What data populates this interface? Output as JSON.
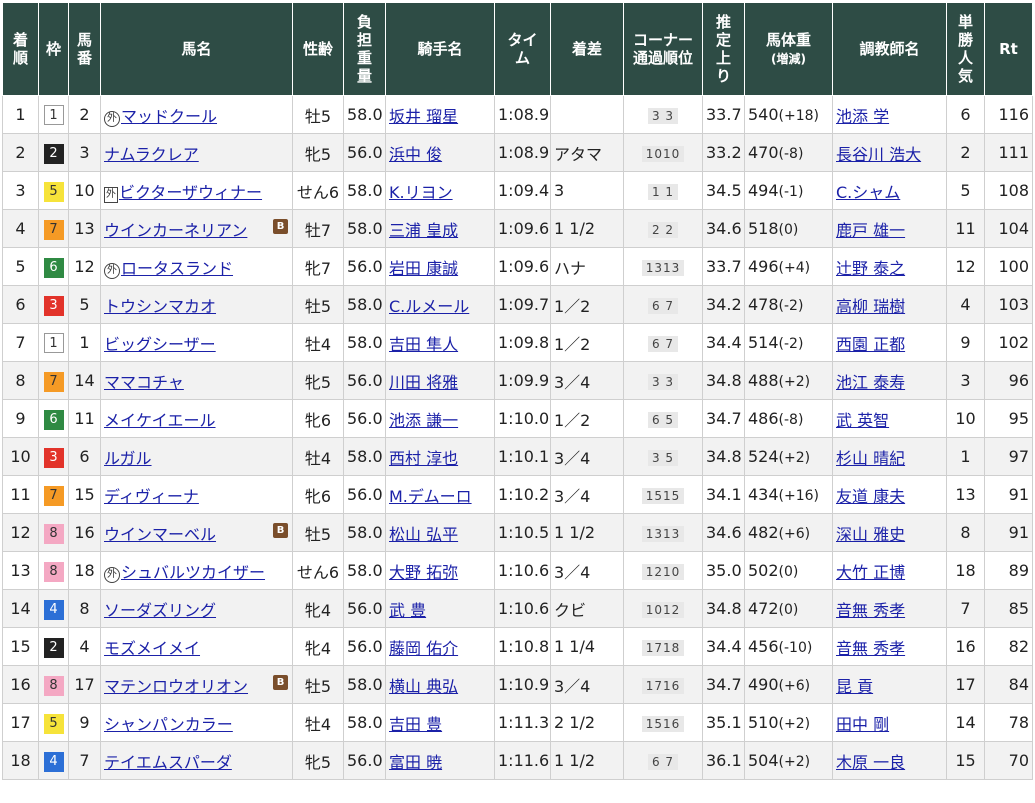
{
  "headers": {
    "rank": [
      "着",
      "順"
    ],
    "waku": [
      "枠"
    ],
    "umaban": [
      "馬",
      "番"
    ],
    "name": [
      "馬名"
    ],
    "sexage": [
      "性齢"
    ],
    "weight": [
      "負",
      "担",
      "重",
      "量"
    ],
    "jockey": [
      "騎手名"
    ],
    "time": [
      "タイ",
      "ム"
    ],
    "margin": [
      "着差"
    ],
    "corner": [
      "コーナー",
      "通過順位"
    ],
    "last3f": [
      "推",
      "定",
      "上",
      "り"
    ],
    "body": [
      "馬体重",
      "(増減)"
    ],
    "trainer": [
      "調教師名"
    ],
    "pop": [
      "単",
      "勝",
      "人",
      "気"
    ],
    "rt": [
      "Rt"
    ]
  },
  "rows": [
    {
      "rank": "1",
      "waku": "1",
      "umaban": "2",
      "mark": "外",
      "mark_style": "maru",
      "name": "マッドクール",
      "blinker": "",
      "sexage": "牡5",
      "weight": "58.0",
      "jockey": "坂井 瑠星",
      "time": "1:08.9",
      "margin": "",
      "corner": "3 3",
      "last3f": "33.7",
      "bodyw": "540",
      "bodychg": "(+18)",
      "trainer": "池添 学",
      "pop": "6",
      "rt": "116"
    },
    {
      "rank": "2",
      "waku": "2",
      "umaban": "3",
      "mark": "",
      "mark_style": "",
      "name": "ナムラクレア",
      "blinker": "",
      "sexage": "牝5",
      "weight": "56.0",
      "jockey": "浜中 俊",
      "time": "1:08.9",
      "margin": "アタマ",
      "corner": "1010",
      "last3f": "33.2",
      "bodyw": "470",
      "bodychg": "(-8)",
      "trainer": "長谷川 浩大",
      "pop": "2",
      "rt": "111"
    },
    {
      "rank": "3",
      "waku": "5",
      "umaban": "10",
      "mark": "外",
      "mark_style": "kaku",
      "name": "ビクターザウィナー",
      "blinker": "",
      "sexage": "せん6",
      "weight": "58.0",
      "jockey": "K.リヨン",
      "time": "1:09.4",
      "margin": "3",
      "corner": "1 1",
      "last3f": "34.5",
      "bodyw": "494",
      "bodychg": "(-1)",
      "trainer": "C.シャム",
      "pop": "5",
      "rt": "108"
    },
    {
      "rank": "4",
      "waku": "7",
      "umaban": "13",
      "mark": "",
      "mark_style": "",
      "name": "ウインカーネリアン",
      "blinker": "B",
      "sexage": "牡7",
      "weight": "58.0",
      "jockey": "三浦 皇成",
      "time": "1:09.6",
      "margin": "1 1/2",
      "corner": "2 2",
      "last3f": "34.6",
      "bodyw": "518",
      "bodychg": "(0)",
      "trainer": "鹿戸 雄一",
      "pop": "11",
      "rt": "104"
    },
    {
      "rank": "5",
      "waku": "6",
      "umaban": "12",
      "mark": "外",
      "mark_style": "maru",
      "name": "ロータスランド",
      "blinker": "",
      "sexage": "牝7",
      "weight": "56.0",
      "jockey": "岩田 康誠",
      "time": "1:09.6",
      "margin": "ハナ",
      "corner": "1313",
      "last3f": "33.7",
      "bodyw": "496",
      "bodychg": "(+4)",
      "trainer": "辻野 泰之",
      "pop": "12",
      "rt": "100"
    },
    {
      "rank": "6",
      "waku": "3",
      "umaban": "5",
      "mark": "",
      "mark_style": "",
      "name": "トウシンマカオ",
      "blinker": "",
      "sexage": "牡5",
      "weight": "58.0",
      "jockey": "C.ルメール",
      "time": "1:09.7",
      "margin": "1／2",
      "corner": "6 7",
      "last3f": "34.2",
      "bodyw": "478",
      "bodychg": "(-2)",
      "trainer": "高柳 瑞樹",
      "pop": "4",
      "rt": "103"
    },
    {
      "rank": "7",
      "waku": "1",
      "umaban": "1",
      "mark": "",
      "mark_style": "",
      "name": "ビッグシーザー",
      "blinker": "",
      "sexage": "牡4",
      "weight": "58.0",
      "jockey": "吉田 隼人",
      "time": "1:09.8",
      "margin": "1／2",
      "corner": "6 7",
      "last3f": "34.4",
      "bodyw": "514",
      "bodychg": "(-2)",
      "trainer": "西園 正都",
      "pop": "9",
      "rt": "102"
    },
    {
      "rank": "8",
      "waku": "7",
      "umaban": "14",
      "mark": "",
      "mark_style": "",
      "name": "ママコチャ",
      "blinker": "",
      "sexage": "牝5",
      "weight": "56.0",
      "jockey": "川田 将雅",
      "time": "1:09.9",
      "margin": "3／4",
      "corner": "3 3",
      "last3f": "34.8",
      "bodyw": "488",
      "bodychg": "(+2)",
      "trainer": "池江 泰寿",
      "pop": "3",
      "rt": "96"
    },
    {
      "rank": "9",
      "waku": "6",
      "umaban": "11",
      "mark": "",
      "mark_style": "",
      "name": "メイケイエール",
      "blinker": "",
      "sexage": "牝6",
      "weight": "56.0",
      "jockey": "池添 謙一",
      "time": "1:10.0",
      "margin": "1／2",
      "corner": "6 5",
      "last3f": "34.7",
      "bodyw": "486",
      "bodychg": "(-8)",
      "trainer": "武 英智",
      "pop": "10",
      "rt": "95"
    },
    {
      "rank": "10",
      "waku": "3",
      "umaban": "6",
      "mark": "",
      "mark_style": "",
      "name": "ルガル",
      "blinker": "",
      "sexage": "牡4",
      "weight": "58.0",
      "jockey": "西村 淳也",
      "time": "1:10.1",
      "margin": "3／4",
      "corner": "3 5",
      "last3f": "34.8",
      "bodyw": "524",
      "bodychg": "(+2)",
      "trainer": "杉山 晴紀",
      "pop": "1",
      "rt": "97"
    },
    {
      "rank": "11",
      "waku": "7",
      "umaban": "15",
      "mark": "",
      "mark_style": "",
      "name": "ディヴィーナ",
      "blinker": "",
      "sexage": "牝6",
      "weight": "56.0",
      "jockey": "M.デムーロ",
      "time": "1:10.2",
      "margin": "3／4",
      "corner": "1515",
      "last3f": "34.1",
      "bodyw": "434",
      "bodychg": "(+16)",
      "trainer": "友道 康夫",
      "pop": "13",
      "rt": "91"
    },
    {
      "rank": "12",
      "waku": "8",
      "umaban": "16",
      "mark": "",
      "mark_style": "",
      "name": "ウインマーベル",
      "blinker": "B",
      "sexage": "牡5",
      "weight": "58.0",
      "jockey": "松山 弘平",
      "time": "1:10.5",
      "margin": "1 1/2",
      "corner": "1313",
      "last3f": "34.6",
      "bodyw": "482",
      "bodychg": "(+6)",
      "trainer": "深山 雅史",
      "pop": "8",
      "rt": "91"
    },
    {
      "rank": "13",
      "waku": "8",
      "umaban": "18",
      "mark": "外",
      "mark_style": "maru",
      "name": "シュバルツカイザー",
      "blinker": "",
      "sexage": "せん6",
      "weight": "58.0",
      "jockey": "大野 拓弥",
      "time": "1:10.6",
      "margin": "3／4",
      "corner": "1210",
      "last3f": "35.0",
      "bodyw": "502",
      "bodychg": "(0)",
      "trainer": "大竹 正博",
      "pop": "18",
      "rt": "89"
    },
    {
      "rank": "14",
      "waku": "4",
      "umaban": "8",
      "mark": "",
      "mark_style": "",
      "name": "ソーダズリング",
      "blinker": "",
      "sexage": "牝4",
      "weight": "56.0",
      "jockey": "武 豊",
      "time": "1:10.6",
      "margin": "クビ",
      "corner": "1012",
      "last3f": "34.8",
      "bodyw": "472",
      "bodychg": "(0)",
      "trainer": "音無 秀孝",
      "pop": "7",
      "rt": "85"
    },
    {
      "rank": "15",
      "waku": "2",
      "umaban": "4",
      "mark": "",
      "mark_style": "",
      "name": "モズメイメイ",
      "blinker": "",
      "sexage": "牝4",
      "weight": "56.0",
      "jockey": "藤岡 佑介",
      "time": "1:10.8",
      "margin": "1 1/4",
      "corner": "1718",
      "last3f": "34.4",
      "bodyw": "456",
      "bodychg": "(-10)",
      "trainer": "音無 秀孝",
      "pop": "16",
      "rt": "82"
    },
    {
      "rank": "16",
      "waku": "8",
      "umaban": "17",
      "mark": "",
      "mark_style": "",
      "name": "マテンロウオリオン",
      "blinker": "B",
      "sexage": "牡5",
      "weight": "58.0",
      "jockey": "横山 典弘",
      "time": "1:10.9",
      "margin": "3／4",
      "corner": "1716",
      "last3f": "34.7",
      "bodyw": "490",
      "bodychg": "(+6)",
      "trainer": "昆 貢",
      "pop": "17",
      "rt": "84"
    },
    {
      "rank": "17",
      "waku": "5",
      "umaban": "9",
      "mark": "",
      "mark_style": "",
      "name": "シャンパンカラー",
      "blinker": "",
      "sexage": "牡4",
      "weight": "58.0",
      "jockey": "吉田 豊",
      "time": "1:11.3",
      "margin": "2 1/2",
      "corner": "1516",
      "last3f": "35.1",
      "bodyw": "510",
      "bodychg": "(+2)",
      "trainer": "田中 剛",
      "pop": "14",
      "rt": "78"
    },
    {
      "rank": "18",
      "waku": "4",
      "umaban": "7",
      "mark": "",
      "mark_style": "",
      "name": "テイエムスパーダ",
      "blinker": "",
      "sexage": "牝5",
      "weight": "56.0",
      "jockey": "富田 暁",
      "time": "1:11.6",
      "margin": "1 1/2",
      "corner": "6 7",
      "last3f": "36.1",
      "bodyw": "504",
      "bodychg": "(+2)",
      "trainer": "木原 一良",
      "pop": "15",
      "rt": "70"
    }
  ]
}
